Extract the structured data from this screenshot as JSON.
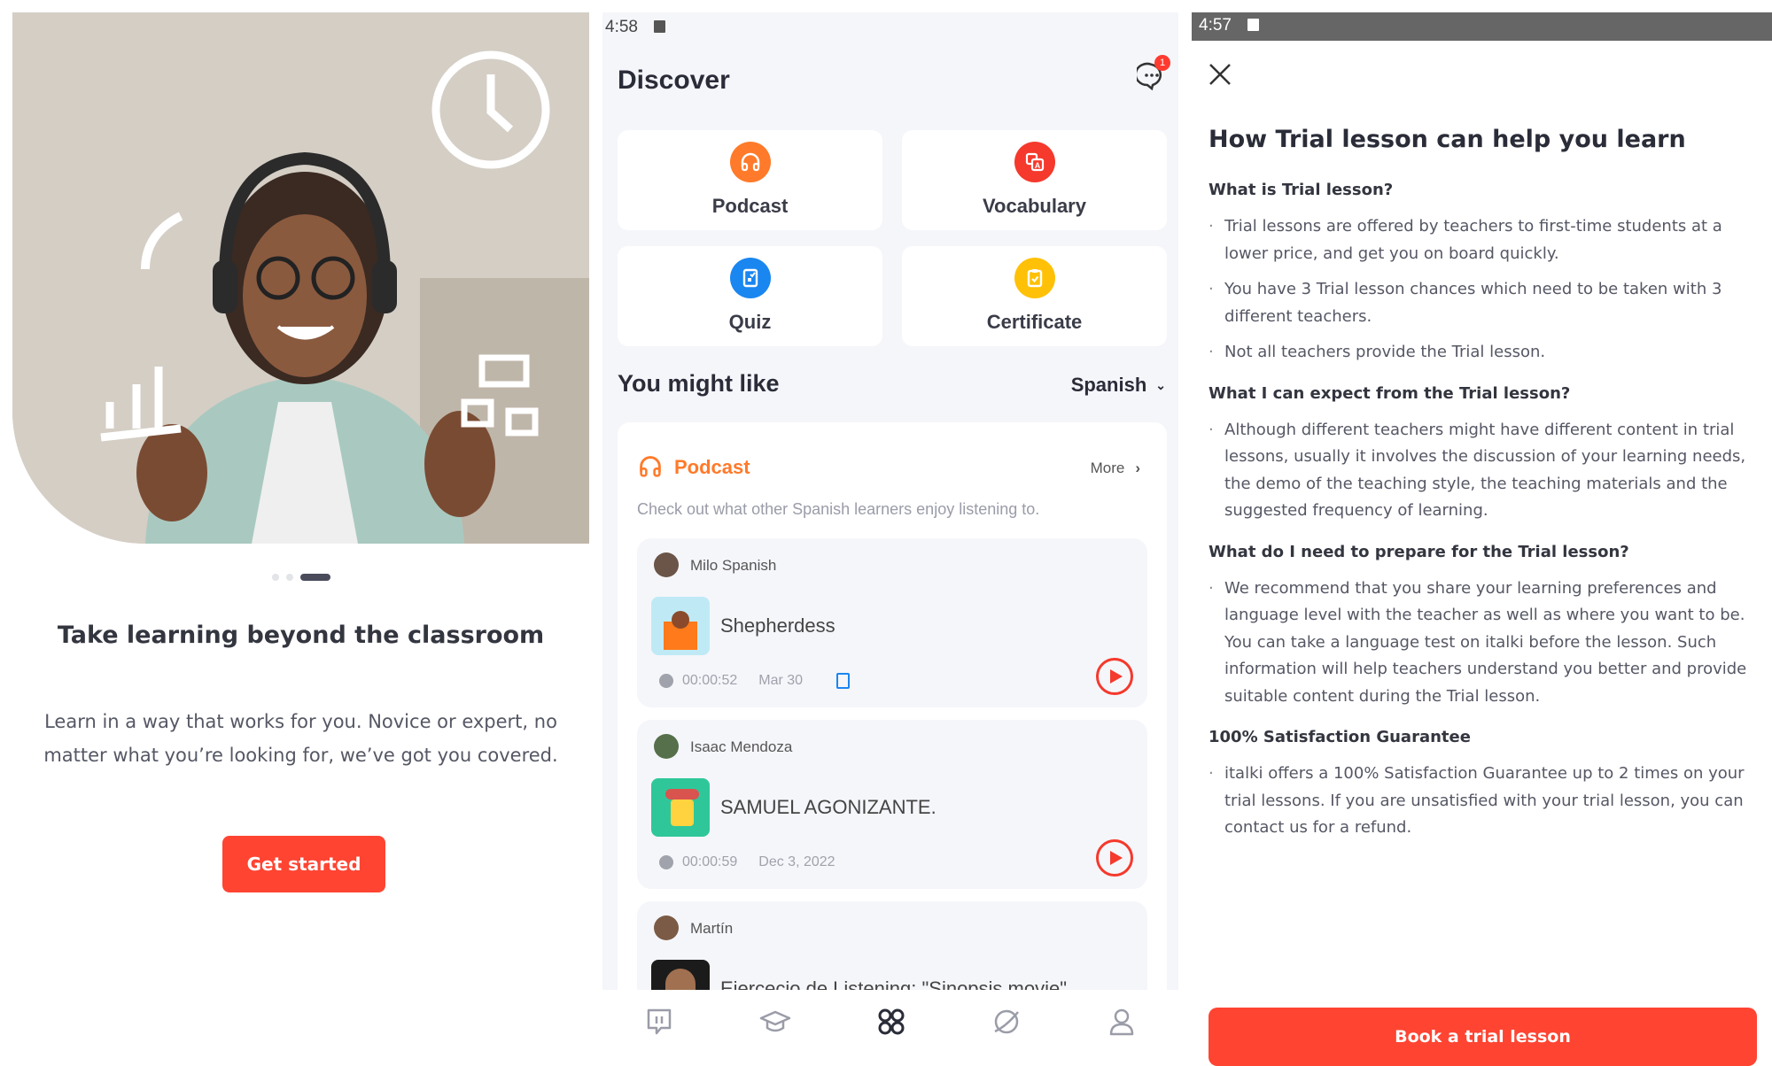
{
  "onboarding": {
    "title": "Take learning beyond the classroom",
    "body": "Learn in a way that works for you. Novice or expert, no matter what you’re looking for, we’ve got you covered.",
    "button": "Get started",
    "pager": {
      "count": 3,
      "active": 3
    }
  },
  "discover": {
    "status_time": "4:58",
    "title": "Discover",
    "notification_count": "1",
    "tiles": [
      {
        "label": "Podcast",
        "icon": "headphones-icon",
        "color": "#ff7a2a"
      },
      {
        "label": "Vocabulary",
        "icon": "flashcards-icon",
        "color": "#f5392c"
      },
      {
        "label": "Quiz",
        "icon": "quiz-icon",
        "color": "#1a86f0"
      },
      {
        "label": "Certificate",
        "icon": "clipboard-check-icon",
        "color": "#ffc107"
      }
    ],
    "section_title": "You might like",
    "language": "Spanish",
    "podcast": {
      "title": "Podcast",
      "more": "More",
      "subtitle": "Check out what other Spanish learners enjoy listening to.",
      "items": [
        {
          "author": "Milo Spanish",
          "title": "Shepherdess",
          "duration": "00:00:52",
          "date": "Mar 30",
          "has_quiz": true
        },
        {
          "author": "Isaac Mendoza",
          "title": "SAMUEL AGONIZANTE.",
          "duration": "00:00:59",
          "date": "Dec 3, 2022",
          "has_quiz": false
        },
        {
          "author": "Martín",
          "title": "Ejercecio de Listening: \"Sinopsis movie\""
        }
      ]
    },
    "nav": [
      "italki-home-icon",
      "graduation-cap-icon",
      "discover-grid-icon",
      "planet-icon",
      "profile-icon"
    ],
    "nav_active": 2
  },
  "trial": {
    "status_time": "4:57",
    "title": "How Trial lesson can help you learn",
    "sections": [
      {
        "heading": "What is Trial lesson?",
        "bullets": [
          "Trial lessons are offered by teachers to first-time students at a lower price, and get you on board quickly.",
          "You have 3 Trial lesson chances which need to be taken with 3 different teachers.",
          "Not all teachers provide the Trial lesson."
        ]
      },
      {
        "heading": "What I can expect from the Trial lesson?",
        "bullets": [
          "Although different teachers might have different content in trial lessons, usually it involves the discussion of your learning needs, the demo of the teaching style, the teaching materials and the suggested frequency of learning."
        ]
      },
      {
        "heading": "What do I need to prepare for the Trial lesson?",
        "bullets": [
          "We recommend that you share your learning preferences and language level with the teacher as well as where you want to be. You can take a language test on italki before the lesson. Such information will help teachers understand you better and provide suitable content during the Trial lesson."
        ]
      },
      {
        "heading": "100% Satisfaction Guarantee",
        "bullets": [
          "italki offers a 100% Satisfaction Guarantee up to 2 times on your trial lessons. If you are unsatisfied with your trial lesson, you can contact us for a refund."
        ]
      }
    ],
    "button": "Book a trial lesson"
  },
  "colors": {
    "accent": "#ff4432",
    "podcast_orange": "#ff7a2a",
    "play_red": "#f5392c"
  }
}
